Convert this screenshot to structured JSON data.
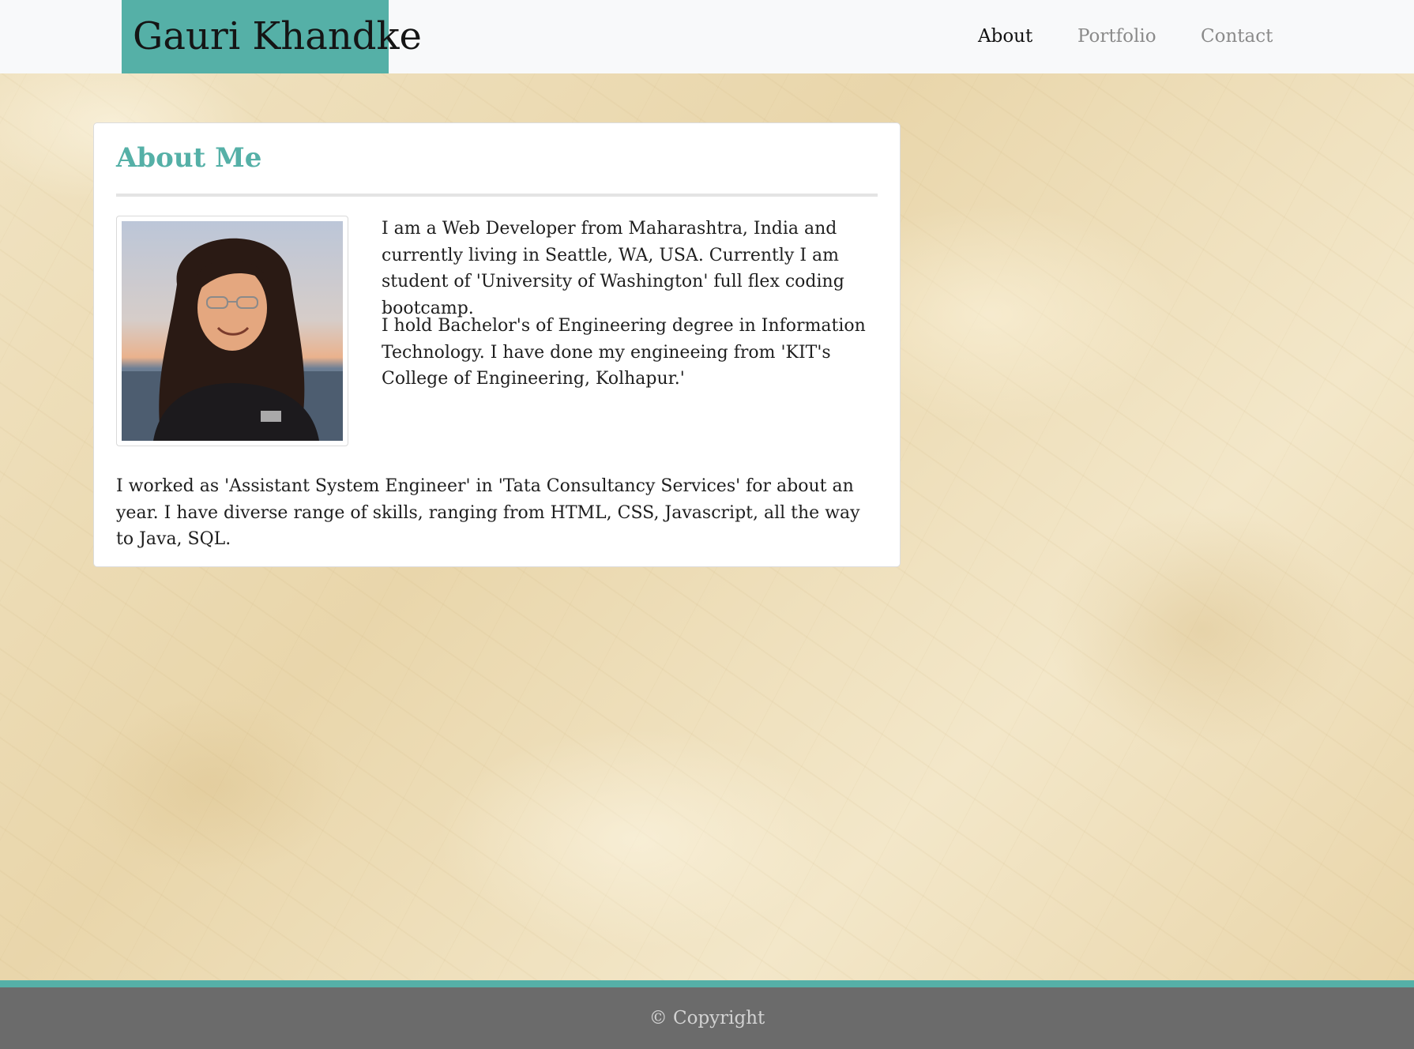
{
  "header": {
    "brand": "Gauri Khandke",
    "nav": [
      {
        "label": "About",
        "active": true
      },
      {
        "label": "Portfolio",
        "active": false
      },
      {
        "label": "Contact",
        "active": false
      }
    ]
  },
  "about": {
    "title": "About Me",
    "paragraphs": [
      "I am a Web Developer from Maharashtra, India and currently living in Seattle, WA, USA. Currently I am student of 'University of Washington' full flex coding bootcamp.",
      "I hold Bachelor's of Engineering degree in Information Technology. I have done my engineeing from 'KIT's College of Engineering, Kolhapur.'",
      "I worked as 'Assistant System Engineer' in 'Tata Consultancy Services' for about an year. I have diverse range of skills, ranging from HTML, CSS, Javascript, all the way to Java, SQL."
    ]
  },
  "footer": {
    "text": "© Copyright"
  },
  "colors": {
    "accent": "#55b0a7",
    "footer_bg": "#6b6b6b",
    "navbar_bg": "#f8f9fa"
  }
}
